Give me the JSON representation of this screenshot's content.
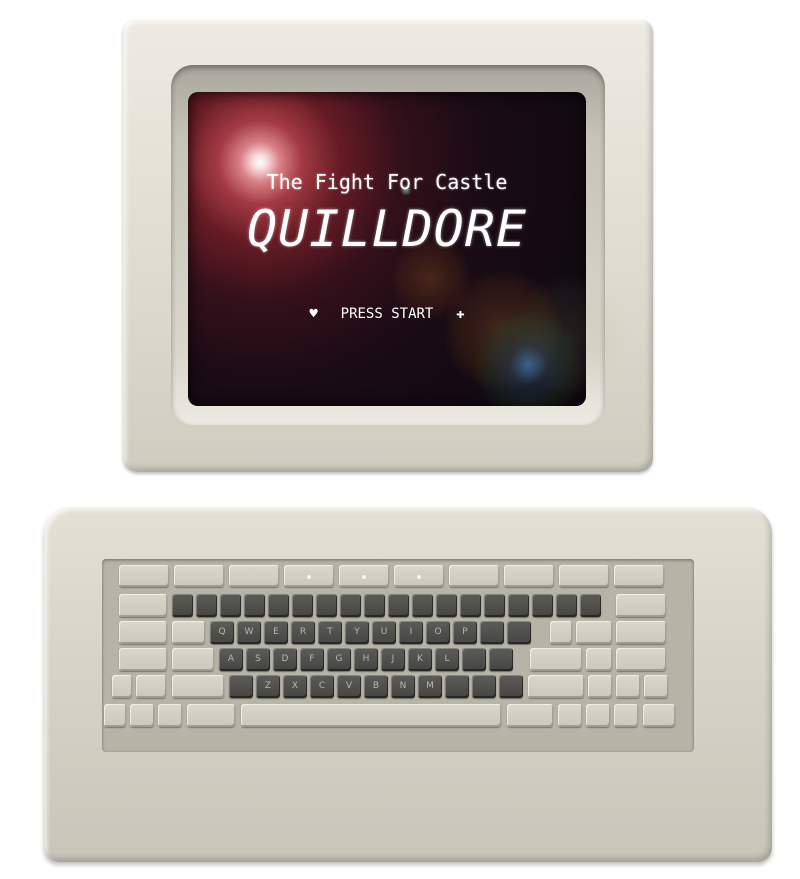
{
  "screen": {
    "subtitle": "The Fight For Castle",
    "title": "QUILLDORE",
    "press_start": "PRESS  START",
    "left_bullet": "♥",
    "right_bullet": "✚"
  },
  "keyboard": {
    "row1": [
      "Q",
      "W",
      "E",
      "R",
      "T",
      "Y",
      "U",
      "I",
      "O",
      "P"
    ],
    "row2": [
      "A",
      "S",
      "D",
      "F",
      "G",
      "H",
      "J",
      "K",
      "L"
    ],
    "row3": [
      "Z",
      "X",
      "C",
      "V",
      "B",
      "N",
      "M"
    ]
  },
  "colors": {
    "casing": "#dedcd0",
    "screen_bg": "#120a12",
    "dark_key": "#454542",
    "light_key": "#cac8bb",
    "text": "#ffffff"
  }
}
